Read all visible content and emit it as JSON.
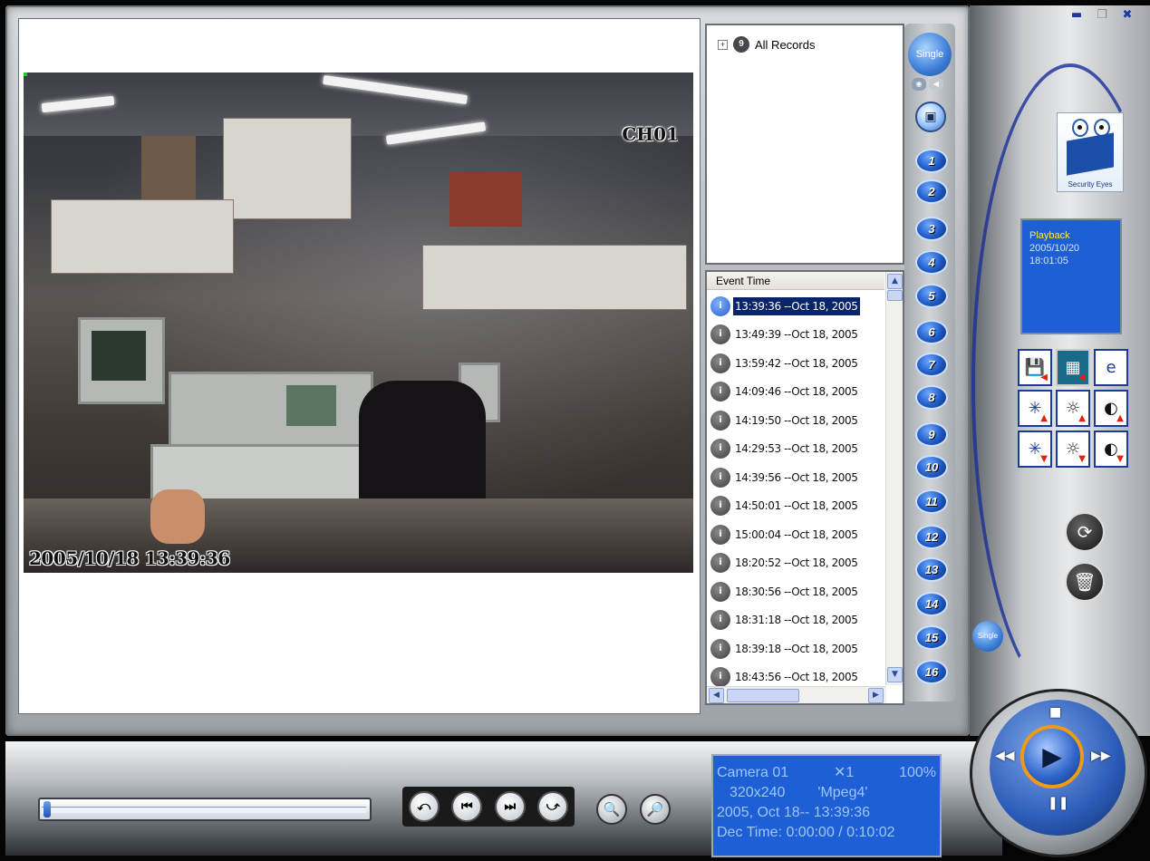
{
  "window": {
    "minimize_glyph": "▬",
    "restore_glyph": "❐",
    "close_glyph": "✖"
  },
  "video": {
    "channel_label": "CH01",
    "timestamp_overlay": "2005/10/18 13:39:36"
  },
  "records": {
    "root_label": "All Records"
  },
  "events": {
    "column_header": "Event Time",
    "items": [
      "13:39:36 --Oct 18, 2005",
      "13:49:39 --Oct 18, 2005",
      "13:59:42 --Oct 18, 2005",
      "14:09:46 --Oct 18, 2005",
      "14:19:50 --Oct 18, 2005",
      "14:29:53 --Oct 18, 2005",
      "14:39:56 --Oct 18, 2005",
      "14:50:01 --Oct 18, 2005",
      "15:00:04 --Oct 18, 2005",
      "18:20:52 --Oct 18, 2005",
      "18:30:56 --Oct 18, 2005",
      "18:31:18 --Oct 18, 2005",
      "18:39:18 --Oct 18, 2005",
      "18:43:56 --Oct 18, 2005"
    ],
    "selected_index": 0
  },
  "channels": {
    "single_label": "Single",
    "numbers": [
      "1",
      "2",
      "3",
      "4",
      "5",
      "6",
      "7",
      "8",
      "9",
      "10",
      "11",
      "12",
      "13",
      "14",
      "15",
      "16"
    ]
  },
  "brand": {
    "name": "Security Eyes"
  },
  "status": {
    "mode": "Playback",
    "date": "2005/10/20",
    "time": "18:01:05"
  },
  "info": {
    "camera": "Camera 01",
    "speed": "✕1",
    "zoom": "100%",
    "resolution": "320x240",
    "codec": "'Mpeg4'",
    "datetime": "2005, Oct 18-- 13:39:36",
    "dec_time": "Dec Time: 0:00:00 / 0:10:02"
  },
  "playback": {
    "progress_fraction": 0.0
  },
  "colors": {
    "accent_blue": "#1f5fd6",
    "status_yellow": "#ffe94a",
    "selection": "#0a246a",
    "joystick_ring": "#f29a16"
  }
}
